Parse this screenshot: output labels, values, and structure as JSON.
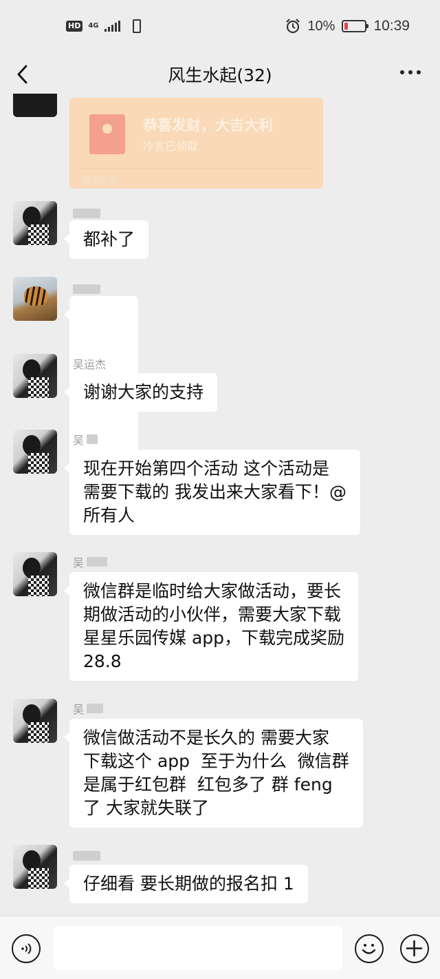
{
  "status_bar": {
    "hd": "HD",
    "network": "4G",
    "battery_percent": "10%",
    "battery_level": 0.1,
    "time": "10:39",
    "icons": [
      "hd-badge",
      "signal-icon",
      "sim-icon",
      "alarm-icon",
      "battery-icon"
    ]
  },
  "nav": {
    "title": "风生水起(32)",
    "back_icon": "chevron-left-icon",
    "more_icon": "more-dots-icon"
  },
  "messages": [
    {
      "type": "red_packet",
      "title": "恭喜发财，大吉大利",
      "status": "冷言已领取",
      "footer": "微信红包"
    },
    {
      "type": "text",
      "sender": "",
      "text": "都补了"
    },
    {
      "type": "emoji",
      "sender": "",
      "emoji": "heart-icon"
    },
    {
      "type": "text",
      "sender": "吴运杰",
      "text": "谢谢大家的支持"
    },
    {
      "type": "text",
      "sender": "吴",
      "text": "现在开始第四个活动 这个活动是\n需要下载的 我发出来大家看下！@\n所有人"
    },
    {
      "type": "text",
      "sender": "吴",
      "text": "微信群是临时给大家做活动，要长\n期做活动的小伙伴，需要大家下载\n星星乐园传媒 app，下载完成奖励\n28.8"
    },
    {
      "type": "text",
      "sender": "吴",
      "text": "微信做活动不是长久的 需要大家\n下载这个 app  至于为什么  微信群\n是属于红包群  红包多了 群 feng\n了 大家就失联了"
    },
    {
      "type": "text",
      "sender": "",
      "text": "仔细看 要长期做的报名扣 1"
    }
  ],
  "input_bar": {
    "voice_icon": "voice-icon",
    "input_value": "",
    "emoji_icon": "emoji-icon",
    "plus_icon": "plus-icon"
  },
  "colors": {
    "background": "#ededed",
    "bubble": "#ffffff",
    "red_packet": "#f9d9b8",
    "battery_low": "#e64340"
  }
}
